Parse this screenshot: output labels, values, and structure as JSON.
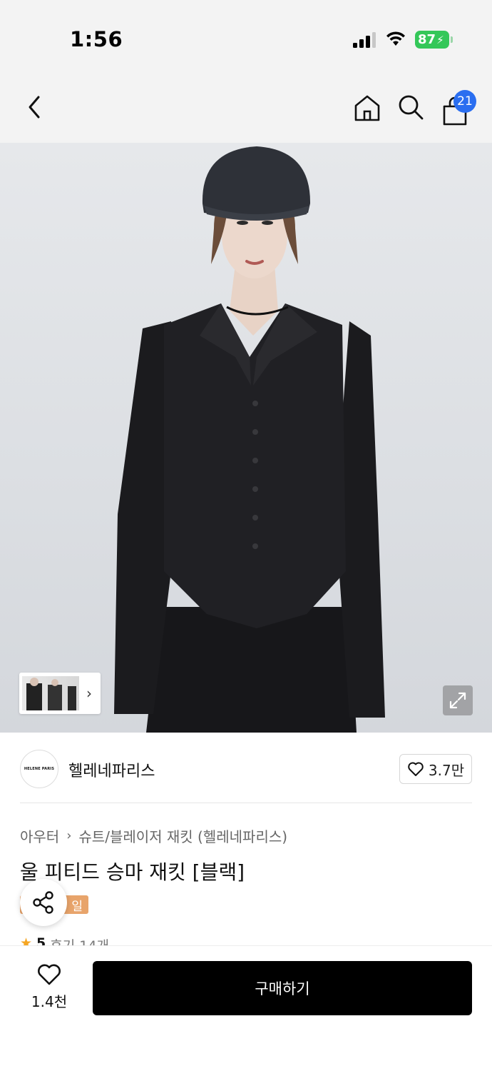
{
  "status_bar": {
    "time": "1:56",
    "battery": "87"
  },
  "nav": {
    "cart_count": "21"
  },
  "brand": {
    "logo_text": "HELENE PARIS",
    "name": "헬레네파리스",
    "likes": "3.7만"
  },
  "breadcrumb": {
    "category": "아우터",
    "subcategory": "슈트/블레이저 재킷 (헬레네파리스)"
  },
  "product": {
    "title": "울 피티드 승마 재킷 [블랙]",
    "delivery_badge": "일"
  },
  "rating": {
    "score": "5",
    "reviews": "후기 14개"
  },
  "bottom_bar": {
    "wish_count": "1.4천",
    "buy_label": "구매하기"
  },
  "colors": {
    "cart_badge": "#2a6ef0",
    "battery": "#34c759",
    "delivery_badge": "#e8a46b",
    "buy_button": "#000000",
    "star": "#f5a623"
  },
  "icons": [
    "signal-icon",
    "wifi-icon",
    "battery-icon",
    "back-arrow-icon",
    "home-icon",
    "search-icon",
    "cart-icon",
    "expand-icon",
    "heart-icon",
    "share-icon",
    "star-icon"
  ]
}
